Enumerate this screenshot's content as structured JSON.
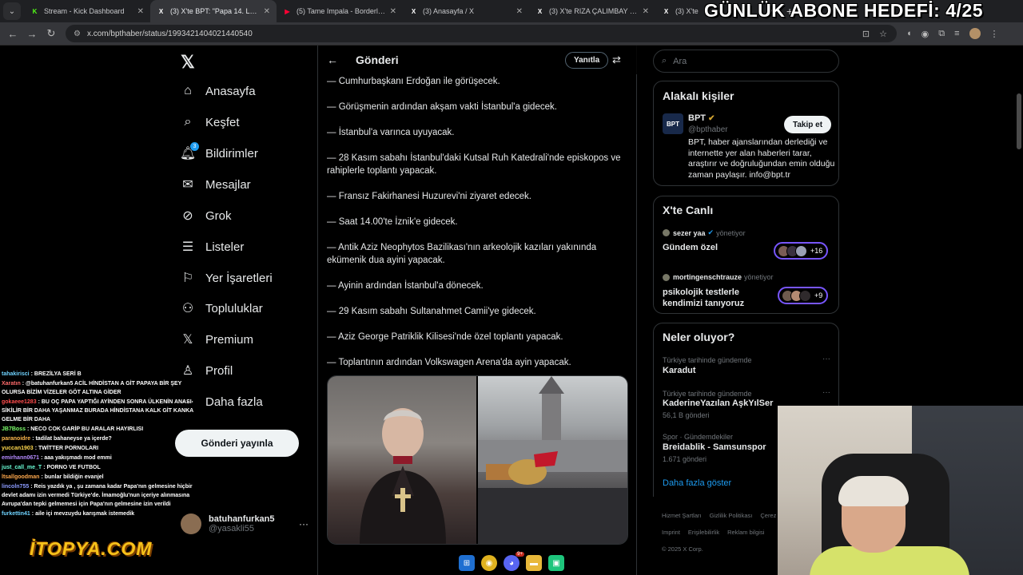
{
  "browser": {
    "tabs": [
      {
        "title": "Stream - Kick Dashboard",
        "favicon": "K",
        "favicon_color": "#53fc18",
        "active": false
      },
      {
        "title": "(3) X'te BPT: \"Papa 14. Leo, 2 gü",
        "favicon": "X",
        "favicon_color": "#ffffff",
        "active": true
      },
      {
        "title": "(5) Tame Impala - Borderline",
        "favicon": "▶",
        "favicon_color": "#ff0033",
        "active": false
      },
      {
        "title": "(3) Anasayfa / X",
        "favicon": "X",
        "favicon_color": "#ffffff",
        "active": false
      },
      {
        "title": "(3) X'te RIZA ÇALIMBAY HAYRAN",
        "favicon": "X",
        "favicon_color": "#ffffff",
        "active": false
      },
      {
        "title": "(3) X'te",
        "favicon": "X",
        "favicon_color": "#ffffff",
        "active": false
      }
    ],
    "new_tab": "+",
    "url": "x.com/bpthaber/status/1993421404021440540"
  },
  "overlay": {
    "goal": "GÜNLÜK ABONE HEDEFİ: 4/25",
    "logo": "İTOPYA.COM"
  },
  "leftnav": {
    "items": [
      {
        "label": "Anasayfa",
        "icon": "home-icon",
        "glyph": "⌂"
      },
      {
        "label": "Keşfet",
        "icon": "search-icon",
        "glyph": "⌕"
      },
      {
        "label": "Bildirimler",
        "icon": "bell-icon",
        "glyph": "🔔︎",
        "badge": "3"
      },
      {
        "label": "Mesajlar",
        "icon": "mail-icon",
        "glyph": "✉"
      },
      {
        "label": "Grok",
        "icon": "grok-icon",
        "glyph": "⊘"
      },
      {
        "label": "Listeler",
        "icon": "list-icon",
        "glyph": "☰"
      },
      {
        "label": "Yer İşaretleri",
        "icon": "bookmark-icon",
        "glyph": "⚐"
      },
      {
        "label": "Topluluklar",
        "icon": "community-icon",
        "glyph": "⚇"
      },
      {
        "label": "Premium",
        "icon": "x-premium-icon",
        "glyph": "𝕏"
      },
      {
        "label": "Profil",
        "icon": "profile-icon",
        "glyph": "♙"
      },
      {
        "label": "Daha fazla",
        "icon": "more-icon",
        "glyph": "⋯"
      }
    ],
    "post_button": "Gönderi yayınla",
    "user": {
      "name": "batuhanfurkan5",
      "handle": "@yasakli55"
    }
  },
  "main": {
    "title": "Gönderi",
    "reply_button": "Yanıtla",
    "lines": [
      "— Cumhurbaşkanı Erdoğan ile görüşecek.",
      "— Görüşmenin ardından akşam vakti İstanbul'a gidecek.",
      "— İstanbul'a varınca uyuyacak.",
      "— 28 Kasım sabahı İstanbul'daki Kutsal Ruh Katedrali'nde episkopos ve rahiplerle toplantı yapacak.",
      "— Fransız Fakirhanesi Huzurevi'ni ziyaret edecek.",
      "— Saat 14.00'te İznik'e gidecek.",
      "— Antik Aziz Neophytos Bazilikası'nın arkeolojik kazıları yakınında ekümenik dua ayini yapacak.",
      "— Ayinin ardından İstanbul'a dönecek.",
      "— 29 Kasım sabahı Sultanahmet Camii'ye gidecek.",
      "— Aziz George Patriklik Kilisesi'nde özel toplantı yapacak.",
      "— Toplantının ardından Volkswagen Arena'da ayin yapacak."
    ]
  },
  "right": {
    "search_placeholder": "Ara",
    "related": {
      "title": "Alakalı kişiler",
      "name": "BPT",
      "avatar": "BPT",
      "handle": "@bpthaber",
      "follow": "Takip et",
      "bio": "BPT, haber ajanslarından derlediği ve internette yer alan haberleri tarar, araştırır ve doğruluğundan emin olduğu zaman paylaşır. info@bpt.tr"
    },
    "live": {
      "title": "X'te Canlı",
      "spaces": [
        {
          "host": "sezer yaa",
          "role": "yönetiyor",
          "title": "Gündem özel",
          "count": "+16"
        },
        {
          "host": "mortingenschtrauze",
          "role": "yönetiyor",
          "title": "psikolojik testlerle kendimizi tanıyoruz",
          "count": "+9"
        }
      ]
    },
    "trends": {
      "title": "Neler oluyor?",
      "items": [
        {
          "meta": "Türkiye tarihinde gündemde",
          "name": "Karadut",
          "count": ""
        },
        {
          "meta": "Türkiye tarihinde gündemde",
          "name": "KaderineYazılan AşkYılSer",
          "count": "56,1 B gönderi"
        },
        {
          "meta": "Spor · Gündemdekiler",
          "name": "Breidablik - Samsunspor",
          "count": "1.671 gönderi"
        }
      ],
      "show_more": "Daha fazla göster"
    },
    "footer": [
      "Hizmet Şartları",
      "Gizlilik Politikası",
      "Çerez",
      "Imprint",
      "Erişilebilirlik",
      "Reklam bilgisi",
      "© 2025 X Corp."
    ]
  },
  "chat": [
    {
      "user": "tahakirisci",
      "color": "#6fd3ff",
      "text": ": BREZİLYA SERİ B"
    },
    {
      "user": "Xaratın",
      "color": "#ff6b6b",
      "text": ": @batuhanfurkan5 ACİL HİNDİSTAN A GİT PAPAYA BİR ŞEY OLURSA BİZİM VİZELER GÖT ALTINA GİDER"
    },
    {
      "user": "gokaeee1283",
      "color": "#ff4d4d",
      "text": ": BU OÇ PAPA YAPTIĞI AYİNDEN SONRA ÜLKENİN ANASI SİKİLİR BİR DAHA YAŞANMAZ BURADA HİNDİSTANA KALK GİT KANKA GELME BİR DAHA"
    },
    {
      "user": "JB7Boss",
      "color": "#7dff6b",
      "text": ": NECO COK GARİP BU ARALAR HAYIRLISI"
    },
    {
      "user": "paranoidre",
      "color": "#ffb84d",
      "text": ": tadilat bahaneyse ya içerde?"
    },
    {
      "user": "yuccan1903",
      "color": "#ffd84d",
      "text": ": TWİTTER PORNOLARI"
    },
    {
      "user": "emirhann0671",
      "color": "#b58bff",
      "text": ": aaa yakışmadı mod emmi"
    },
    {
      "user": "just_call_me_T",
      "color": "#6bffd8",
      "text": ": PORNO VE FUTBOL"
    },
    {
      "user": "ltsallgoodman",
      "color": "#ffa94d",
      "text": ": bunlar bildiğin evanjel"
    },
    {
      "user": "lincoln755",
      "color": "#8b9bff",
      "text": ": Reis yazdık ya , şu zamana kadar Papa'nın gelmesine hiçbir devlet adamı izin vermedi Türkiye'de. İmamoğlu'nun içeriye alınmasına Avrupa'dan tepki gelmemesi için Papa'nın gelmesine izin verildi"
    },
    {
      "user": "furkettin41",
      "color": "#6fd3ff",
      "text": ": aile içi mevzuydu karışmak istemedik"
    }
  ],
  "taskbar": {
    "notif_count": "9+"
  }
}
